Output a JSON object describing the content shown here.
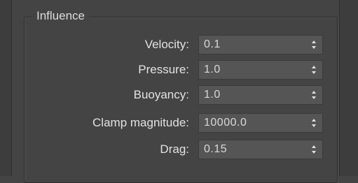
{
  "group": {
    "title": "Influence"
  },
  "fields": [
    {
      "label": "Velocity:",
      "value": "0.1"
    },
    {
      "label": "Pressure:",
      "value": "1.0"
    },
    {
      "label": "Buoyancy:",
      "value": "1.0"
    },
    {
      "label": "Clamp magnitude:",
      "value": "10000.0"
    },
    {
      "label": "Drag:",
      "value": "0.15"
    }
  ],
  "icons": {
    "spinner": "up-down-arrows-icon"
  },
  "colors": {
    "panel_bg": "#444444",
    "field_bg": "#555555",
    "text": "#e2e2e2"
  }
}
